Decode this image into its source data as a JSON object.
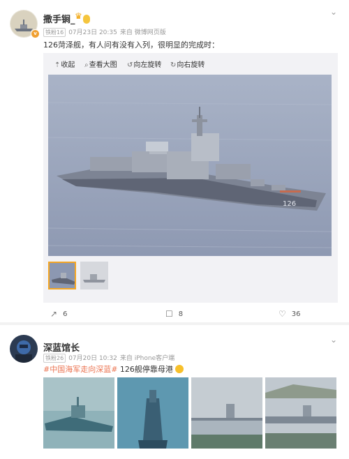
{
  "post1": {
    "username": "撒手锏_",
    "level_badge": "",
    "crown_icon": "crown-icon",
    "verify_badge": "v",
    "fan_tag": "铁粉16",
    "date": "07月23日 20:35",
    "source": "来自 微博网页版",
    "more_icon": "chevron-down-icon",
    "text": "126菏泽舰，有人问有没有入列，很明显的完成时：",
    "toolbar": {
      "collapse": "收起",
      "view_large": "查看大图",
      "rotate_left": "向左旋转",
      "rotate_right": "向右旋转"
    },
    "hull_number": "126",
    "actions": {
      "share": "6",
      "comment": "8",
      "like": "36"
    }
  },
  "post2": {
    "username": "深蓝馆长",
    "fan_tag": "铁粉26",
    "date": "07月20日 10:32",
    "source": "来自 iPhone客户端",
    "more_icon": "chevron-down-icon",
    "hashtag": "#中国海军走向深蓝#",
    "text": " 126舰停靠母港",
    "emoji_icon": "laugh-emoji-icon"
  },
  "colors": {
    "link": "#eb7350",
    "muted": "#999999",
    "badge": "#f5c53d"
  }
}
